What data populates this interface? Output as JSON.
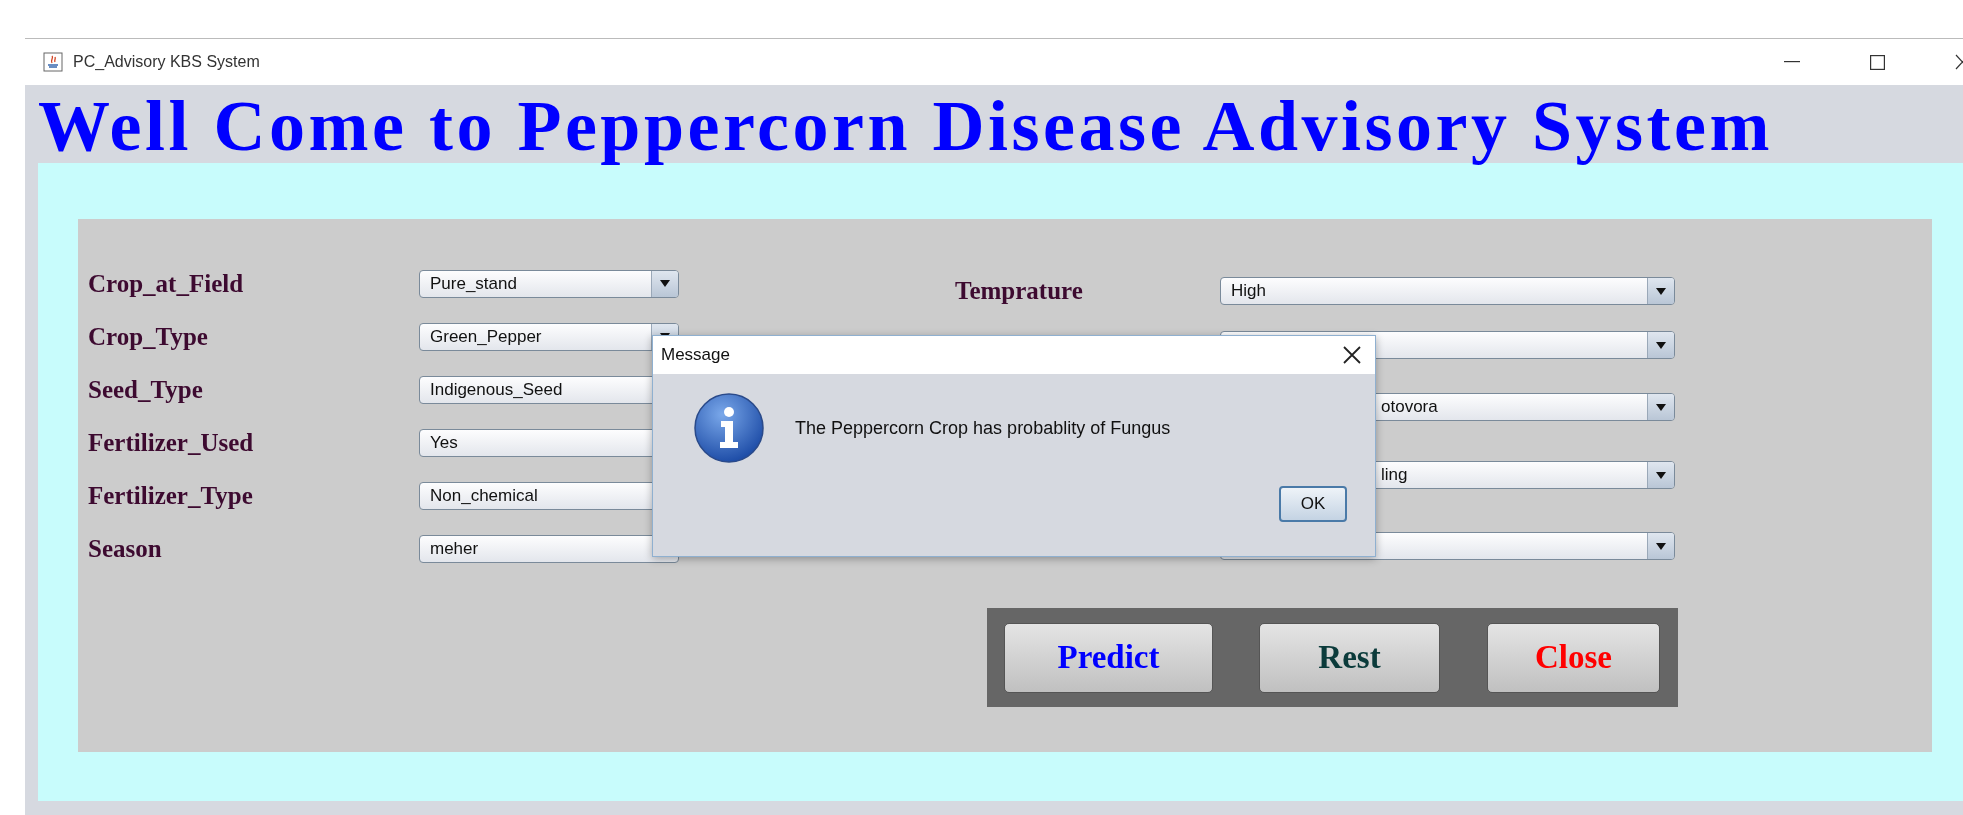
{
  "window": {
    "title": "PC_Advisory KBS System"
  },
  "heading": "Well Come to Peppercorn Disease Advisory System",
  "left_fields": [
    {
      "label": "Crop_at_Field",
      "value": "Pure_stand",
      "covered": false
    },
    {
      "label": "Crop_Type",
      "value": "Green_Pepper",
      "covered": false
    },
    {
      "label": "Seed_Type",
      "value": "Indigenous_Seed",
      "covered": true
    },
    {
      "label": "Fertilizer_Used",
      "value": "Yes",
      "covered": true
    },
    {
      "label": "Fertilizer_Type",
      "value": "Non_chemical",
      "covered": true
    },
    {
      "label": "Season",
      "value": "meher",
      "covered": true
    }
  ],
  "right_fields": [
    {
      "kind": "dropdown",
      "label": "Temprature",
      "value": "High",
      "covered": false
    },
    {
      "kind": "dropdown"
    },
    {
      "kind": "dropdown",
      "value": "otovora",
      "covered": true
    },
    {
      "kind": "dropdown",
      "value": "ling",
      "covered": true
    },
    {
      "kind": "dropdown"
    }
  ],
  "buttons": [
    {
      "label": "Predict",
      "color": "#0000ff"
    },
    {
      "label": "Rest",
      "color": "#0b3b3b"
    },
    {
      "label": "Close",
      "color": "#ff0000"
    }
  ],
  "dialog": {
    "title": "Message",
    "message": "The Peppercorn Crop has probablity of Fungus",
    "button": "OK"
  }
}
